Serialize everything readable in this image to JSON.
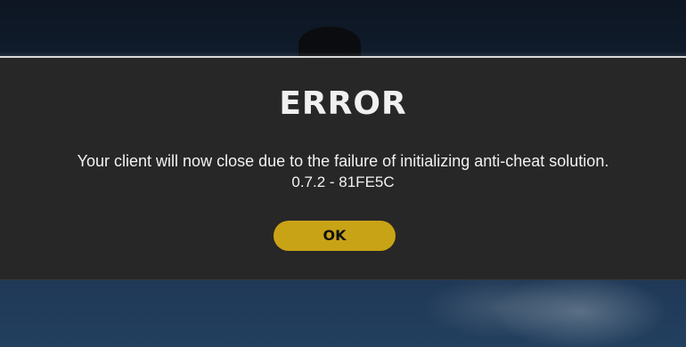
{
  "dialog": {
    "title": "ERROR",
    "message": "Your client will now close due to the failure of initializing anti-cheat solution.",
    "version": "0.7.2 - 81FE5C",
    "ok_label": "OK"
  },
  "colors": {
    "panel_background": "#272727",
    "ok_button": "#c9a316",
    "text": "#f2f2f2"
  }
}
